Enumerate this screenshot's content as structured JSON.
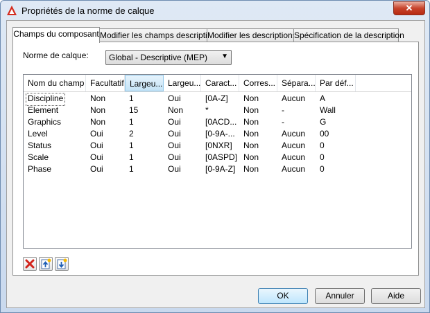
{
  "window": {
    "title": "Propriétés de la norme de calque"
  },
  "tabs": [
    {
      "label": "Champs du composant"
    },
    {
      "label": "Modifier les champs descriptifs"
    },
    {
      "label": "Modifier les descriptions"
    },
    {
      "label": "Spécification de la description"
    }
  ],
  "layer_norm": {
    "label": "Norme de calque:",
    "value": "Global - Descriptive (MEP)"
  },
  "grid": {
    "columns": [
      "Nom du champ",
      "Facultatif",
      "Largeu...",
      "Largeu...",
      "Caract...",
      "Corres...",
      "Sépara...",
      "Par déf..."
    ],
    "rows": [
      [
        "Discipline",
        "Non",
        "1",
        "Oui",
        "[0A-Z]",
        "Non",
        "Aucun",
        "A"
      ],
      [
        "Element",
        "Non",
        "15",
        "Non",
        "*",
        "Non",
        "-",
        "Wall"
      ],
      [
        "Graphics",
        "Non",
        "1",
        "Oui",
        "[0ACD...",
        "Non",
        "-",
        "G"
      ],
      [
        "Level",
        "Oui",
        "2",
        "Oui",
        "[0-9A-...",
        "Non",
        "Aucun",
        "00"
      ],
      [
        "Status",
        "Oui",
        "1",
        "Oui",
        "[0NXR]",
        "Non",
        "Aucun",
        "0"
      ],
      [
        "Scale",
        "Oui",
        "1",
        "Oui",
        "[0ASPD]",
        "Non",
        "Aucun",
        "0"
      ],
      [
        "Phase",
        "Oui",
        "1",
        "Oui",
        "[0-9A-Z]",
        "Non",
        "Aucun",
        "0"
      ]
    ]
  },
  "footer": {
    "ok": "OK",
    "cancel": "Annuler",
    "help": "Aide"
  },
  "close_glyph": "✕"
}
